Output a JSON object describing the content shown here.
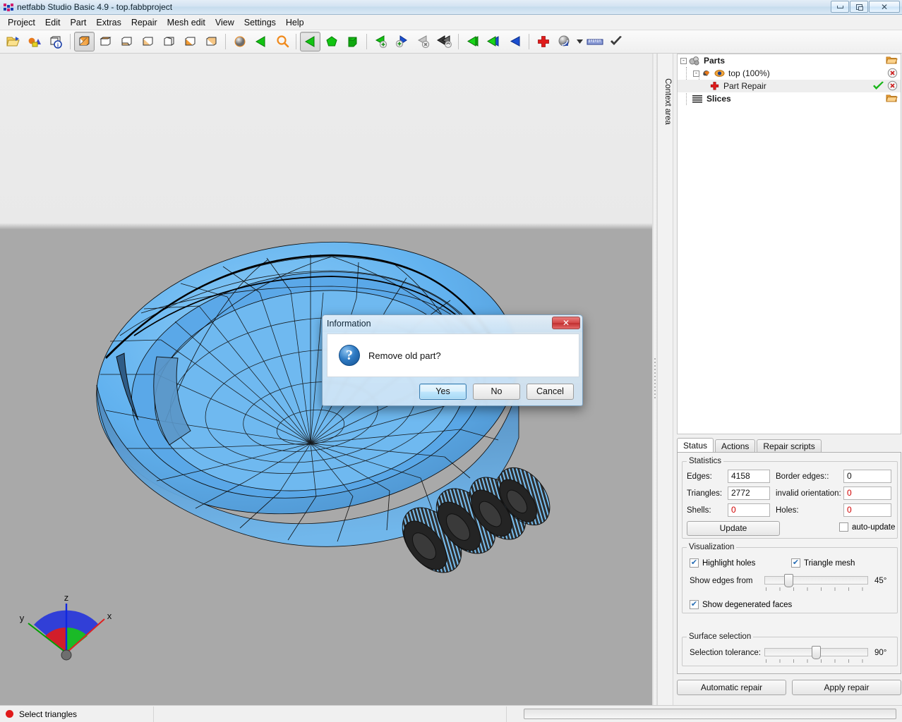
{
  "window": {
    "title": "netfabb Studio Basic 4.9 - top.fabbproject",
    "app_icon": "netfabb-logo-icon",
    "controls": [
      {
        "name": "minimize",
        "glyph": "minimize-icon"
      },
      {
        "name": "restore",
        "glyph": "restore-icon"
      },
      {
        "name": "close",
        "glyph": "close-icon"
      }
    ]
  },
  "menu": {
    "items": [
      "Project",
      "Edit",
      "Part",
      "Extras",
      "Repair",
      "Mesh edit",
      "View",
      "Settings",
      "Help"
    ]
  },
  "toolbar": {
    "groups": [
      {
        "buttons": [
          {
            "name": "open-project-icon",
            "title": "Open project"
          },
          {
            "name": "add-part-icon",
            "title": "Add part"
          },
          {
            "name": "part-info-icon",
            "title": "Part information"
          }
        ]
      },
      {
        "buttons": [
          {
            "name": "view-standard-icon",
            "title": "Standard view",
            "active": true
          },
          {
            "name": "view-top-icon",
            "title": "Top view"
          },
          {
            "name": "view-bottom-icon",
            "title": "Bottom view"
          },
          {
            "name": "view-front-icon",
            "title": "Front view"
          },
          {
            "name": "view-back-icon",
            "title": "Back view"
          },
          {
            "name": "view-left-icon",
            "title": "Left view"
          },
          {
            "name": "view-right-icon",
            "title": "Right view"
          }
        ]
      },
      {
        "buttons": [
          {
            "name": "shading-sphere-icon",
            "title": "Shading"
          },
          {
            "name": "select-green-triangle-icon",
            "title": "Select"
          },
          {
            "name": "zoom-magnifier-icon",
            "title": "Zoom"
          }
        ]
      },
      {
        "buttons": [
          {
            "name": "select-triangles-icon",
            "title": "Select triangles",
            "active": true
          },
          {
            "name": "select-surface-icon",
            "title": "Select surface"
          },
          {
            "name": "select-shell-icon",
            "title": "Select shell"
          }
        ]
      },
      {
        "buttons": [
          {
            "name": "add-selection-icon",
            "title": "Add to selection"
          },
          {
            "name": "add-surface-selection-icon",
            "title": "Add surface to selection"
          },
          {
            "name": "remove-selection-icon",
            "title": "Remove from selection"
          },
          {
            "name": "invert-selection-icon",
            "title": "Invert selection"
          }
        ]
      },
      {
        "buttons": [
          {
            "name": "duplicate-triangles-icon",
            "title": "Duplicate triangles"
          },
          {
            "name": "flip-triangles-icon",
            "title": "Flip triangles"
          },
          {
            "name": "fill-triangles-icon",
            "title": "Fill triangles"
          }
        ]
      },
      {
        "buttons": [
          {
            "name": "repair-cross-icon",
            "title": "Repair part"
          },
          {
            "name": "shells-sphere-icon",
            "title": "Shells",
            "dropdown": true
          },
          {
            "name": "measure-ruler-icon",
            "title": "Measure"
          },
          {
            "name": "apply-checkmark-icon",
            "title": "Apply"
          }
        ]
      }
    ]
  },
  "context_area": {
    "label": "Context area"
  },
  "viewport": {
    "axis_gizmo": {
      "x_label": "x",
      "y_label": "y",
      "z_label": "z",
      "x_color": "#e02020",
      "y_color": "#00a000",
      "z_color": "#1028e0"
    },
    "model": {
      "mesh_fill": "#5aaeee",
      "mesh_fill_dark": "#4f86b8",
      "mesh_edge": "#000000",
      "background_top": "#ececec",
      "background_bottom": "#a9a9a9"
    }
  },
  "tree": {
    "nodes": [
      {
        "label": "Parts",
        "icon": "parts-spheres-icon",
        "expander": "-",
        "bold": true,
        "indent": 0,
        "actions": [
          "open-folder-icon"
        ]
      },
      {
        "label": "top (100%)",
        "icon": "part-mesh-icon",
        "icon2": "eye-visible-icon",
        "expander": "-",
        "bold": false,
        "indent": 1,
        "actions": [
          "remove-x-icon"
        ]
      },
      {
        "label": "Part Repair",
        "icon": "repair-cross-icon",
        "expander": "",
        "bold": false,
        "indent": 2,
        "selected": true,
        "actions": [
          "apply-checkmark-icon",
          "remove-x-icon"
        ]
      },
      {
        "label": "Slices",
        "icon": "slices-stack-icon",
        "expander": "",
        "bold": true,
        "indent": 0,
        "actions": [
          "open-folder-icon"
        ]
      }
    ]
  },
  "panel": {
    "tabs": [
      {
        "label": "Status",
        "active": true
      },
      {
        "label": "Actions",
        "active": false
      },
      {
        "label": "Repair scripts",
        "active": false
      }
    ],
    "statistics": {
      "legend": "Statistics",
      "fields": [
        {
          "label": "Edges:",
          "value": "4158",
          "red": false
        },
        {
          "label": "Border edges::",
          "value": "0",
          "red": false
        },
        {
          "label": "Triangles:",
          "value": "2772",
          "red": false
        },
        {
          "label": "invalid orientation:",
          "value": "0",
          "red": true
        },
        {
          "label": "Shells:",
          "value": "0",
          "red": true
        },
        {
          "label": "Holes:",
          "value": "0",
          "red": true
        }
      ],
      "update_button": "Update",
      "auto_update_label": "auto-update",
      "auto_update_checked": false
    },
    "visualization": {
      "legend": "Visualization",
      "highlight_holes_label": "Highlight holes",
      "highlight_holes_checked": true,
      "triangle_mesh_label": "Triangle mesh",
      "triangle_mesh_checked": true,
      "show_edges_label": "Show edges from",
      "show_edges_value": "45°",
      "show_edges_percent": 22,
      "show_degenerated_label": "Show degenerated faces",
      "show_degenerated_checked": true
    },
    "surface_selection": {
      "legend": "Surface selection",
      "tolerance_label": "Selection tolerance:",
      "tolerance_value": "90°",
      "tolerance_percent": 50
    },
    "buttons": {
      "automatic_repair": "Automatic repair",
      "apply_repair": "Apply repair"
    }
  },
  "dialog": {
    "title": "Information",
    "message": "Remove old part?",
    "icon": "question-mark-icon",
    "close_glyph": "close-icon",
    "buttons": [
      {
        "label": "Yes",
        "default": true
      },
      {
        "label": "No",
        "default": false
      },
      {
        "label": "Cancel",
        "default": false
      }
    ]
  },
  "statusbar": {
    "mode_text": "Select triangles",
    "mode_dot_color": "#e01b1b",
    "progress_percent": 0
  }
}
